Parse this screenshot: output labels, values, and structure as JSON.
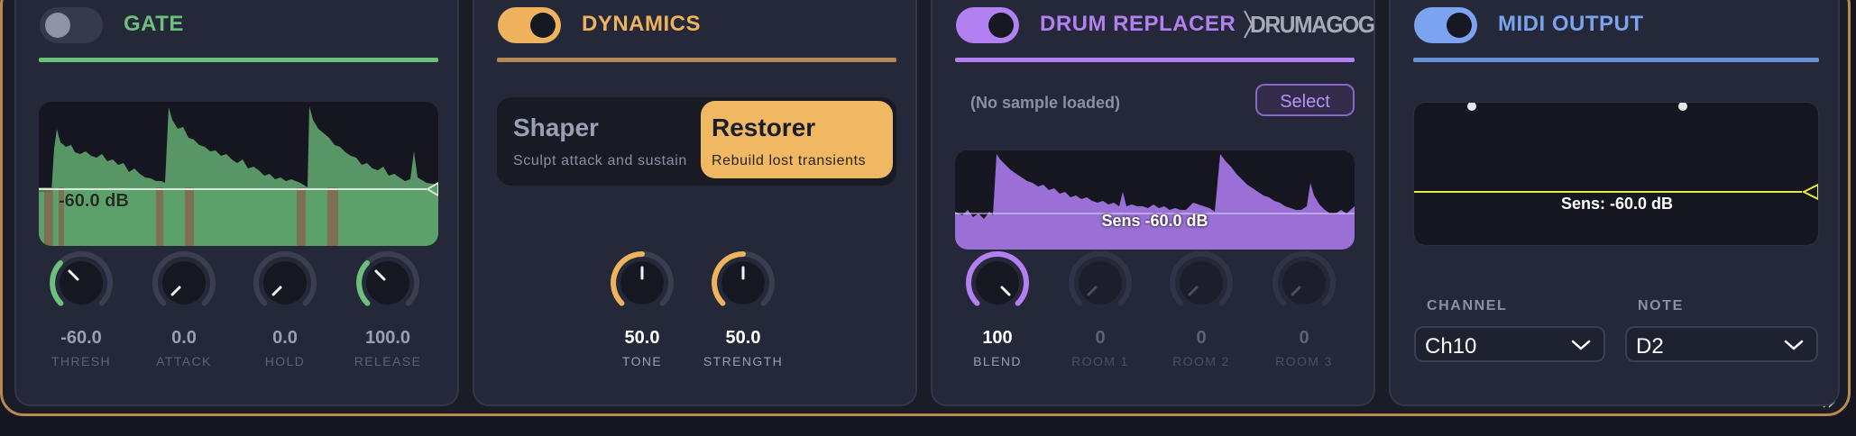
{
  "gate": {
    "title": "GATE",
    "enabled": false,
    "threshold_readout": "-60.0 dB",
    "knobs": [
      {
        "value": "-60.0",
        "label": "THRESH"
      },
      {
        "value": "0.0",
        "label": "ATTACK"
      },
      {
        "value": "0.0",
        "label": "HOLD"
      },
      {
        "value": "100.0",
        "label": "RELEASE"
      }
    ]
  },
  "dynamics": {
    "title": "DYNAMICS",
    "enabled": true,
    "modes": [
      {
        "name": "Shaper",
        "desc": "Sculpt attack and sustain",
        "selected": false
      },
      {
        "name": "Restorer",
        "desc": "Rebuild lost transients",
        "selected": true
      }
    ],
    "knobs": [
      {
        "value": "50.0",
        "label": "TONE"
      },
      {
        "value": "50.0",
        "label": "STRENGTH"
      }
    ]
  },
  "drum_replacer": {
    "title": "DRUM REPLACER",
    "logo": "DRUMAGOG",
    "enabled": true,
    "sample_status": "(No sample loaded)",
    "select_label": "Select",
    "sens_readout": "Sens -60.0 dB",
    "knobs": [
      {
        "value": "100",
        "label": "BLEND"
      },
      {
        "value": "0",
        "label": "ROOM 1"
      },
      {
        "value": "0",
        "label": "ROOM 2"
      },
      {
        "value": "0",
        "label": "ROOM 3"
      }
    ]
  },
  "midi_output": {
    "title": "MIDI OUTPUT",
    "enabled": true,
    "sens_readout": "Sens: -60.0 dB",
    "channel_label": "CHANNEL",
    "channel_value": "Ch10",
    "note_label": "NOTE",
    "note_value": "D2"
  },
  "colors": {
    "gate": "#6cc07c",
    "dynamics": "#eeb35c",
    "drum_replacer": "#b280f0",
    "midi": "#7aa4f0"
  }
}
